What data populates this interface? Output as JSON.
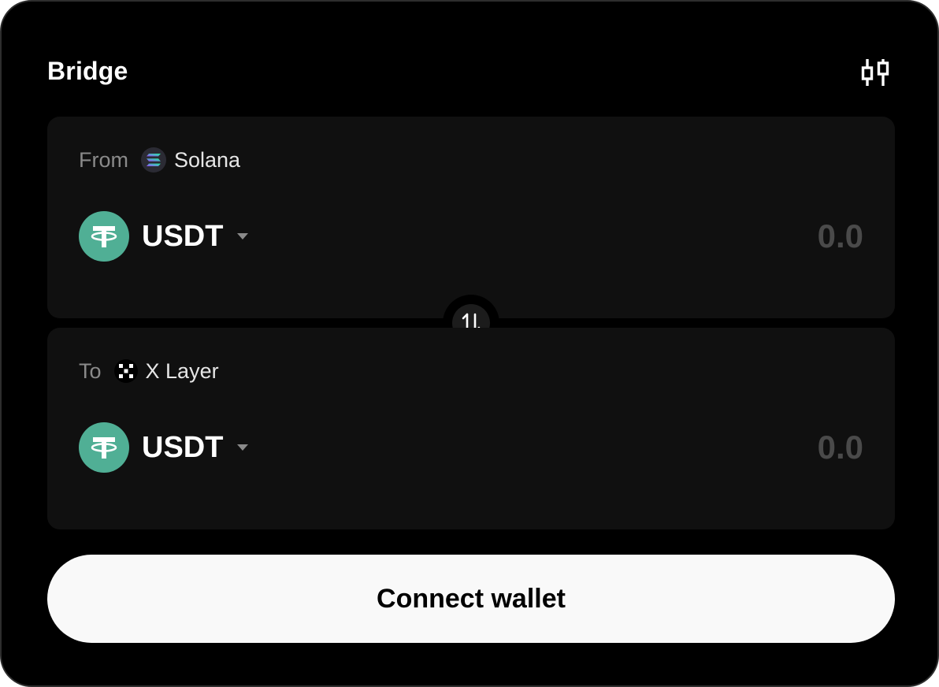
{
  "header": {
    "title": "Bridge",
    "settings_icon": "sliders-icon"
  },
  "from": {
    "label": "From",
    "network": {
      "name": "Solana",
      "icon": "solana-icon"
    },
    "token": {
      "symbol": "USDT",
      "icon": "tether-icon",
      "color": "#50af95"
    },
    "amount": {
      "value": "",
      "placeholder": "0.0"
    }
  },
  "swap": {
    "icon": "swap-arrows-icon"
  },
  "to": {
    "label": "To",
    "network": {
      "name": "X Layer",
      "icon": "x-layer-icon"
    },
    "token": {
      "symbol": "USDT",
      "icon": "tether-icon",
      "color": "#50af95"
    },
    "amount": {
      "value": "",
      "placeholder": "0.0"
    }
  },
  "actions": {
    "connect_label": "Connect wallet"
  }
}
